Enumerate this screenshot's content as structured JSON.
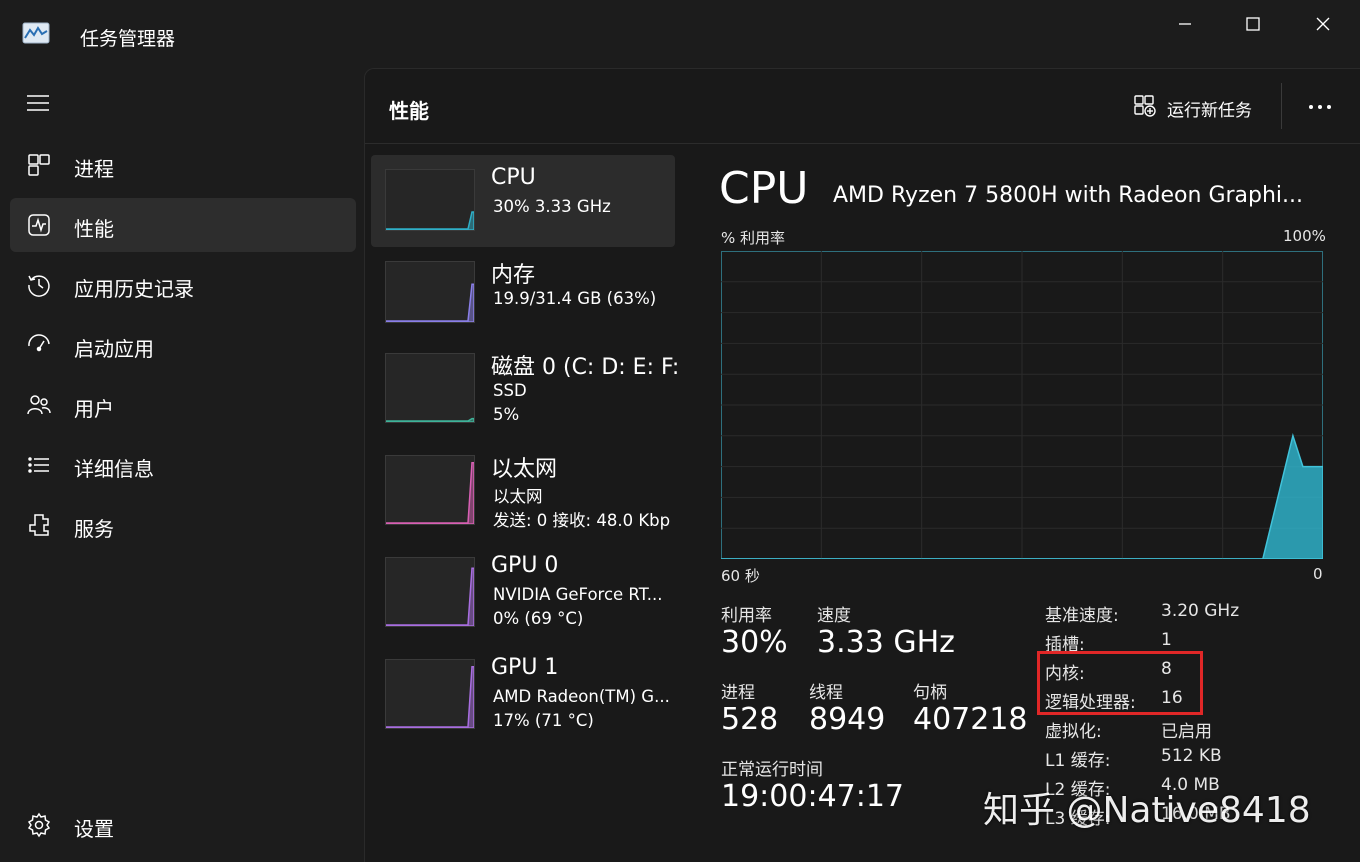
{
  "window": {
    "title": "任务管理器"
  },
  "sidebar": {
    "items": [
      {
        "label": "进程",
        "icon": "processes-icon"
      },
      {
        "label": "性能",
        "icon": "performance-icon",
        "active": true
      },
      {
        "label": "应用历史记录",
        "icon": "history-icon"
      },
      {
        "label": "启动应用",
        "icon": "startup-icon"
      },
      {
        "label": "用户",
        "icon": "users-icon"
      },
      {
        "label": "详细信息",
        "icon": "details-icon"
      },
      {
        "label": "服务",
        "icon": "services-icon"
      }
    ],
    "settings_label": "设置"
  },
  "header": {
    "title": "性能",
    "run_task_label": "运行新任务"
  },
  "resources": [
    {
      "name": "CPU",
      "line1": "30%  3.33 GHz",
      "line2": "",
      "color": "#2fb0c8",
      "level": 0.3
    },
    {
      "name": "内存",
      "line1": "19.9/31.4 GB (63%)",
      "line2": "",
      "color": "#8a7fe8",
      "level": 0.63
    },
    {
      "name": "磁盘 0 (C: D: E: F:",
      "line1": "SSD",
      "line2": "5%",
      "color": "#3fb39a",
      "level": 0.05
    },
    {
      "name": "以太网",
      "line1": "以太网",
      "line2": "发送: 0 接收: 48.0 Kbp",
      "color": "#d860b4",
      "level": 0.9
    },
    {
      "name": "GPU 0",
      "line1": "NVIDIA GeForce RT...",
      "line2": "0% (69 °C)",
      "color": "#a86ee0",
      "level": 0.85
    },
    {
      "name": "GPU 1",
      "line1": "AMD Radeon(TM) G...",
      "line2": "17% (71 °C)",
      "color": "#a86ee0",
      "level": 0.9
    }
  ],
  "cpu": {
    "heading": "CPU",
    "model": "AMD Ryzen 7 5800H with Radeon Graphi...",
    "util_axis_label": "% 利用率",
    "util_axis_max": "100%",
    "time_axis_left": "60 秒",
    "time_axis_right": "0",
    "stats": {
      "util_label": "利用率",
      "util_value": "30%",
      "speed_label": "速度",
      "speed_value": "3.33 GHz",
      "proc_label": "进程",
      "proc_value": "528",
      "thread_label": "线程",
      "thread_value": "8949",
      "handle_label": "句柄",
      "handle_value": "407218",
      "uptime_label": "正常运行时间",
      "uptime_value": "19:00:47:17"
    },
    "details": [
      {
        "key": "基准速度:",
        "value": "3.20 GHz"
      },
      {
        "key": "插槽:",
        "value": "1"
      },
      {
        "key": "内核:",
        "value": "8"
      },
      {
        "key": "逻辑处理器:",
        "value": "16"
      },
      {
        "key": "虚拟化:",
        "value": "已启用"
      },
      {
        "key": "L1 缓存:",
        "value": "512 KB"
      },
      {
        "key": "L2 缓存:",
        "value": "4.0 MB"
      },
      {
        "key": "L3 缓存:",
        "value": "16.0 MB"
      }
    ]
  },
  "chart_data": {
    "type": "area",
    "ylim": [
      0,
      100
    ],
    "x": [
      0,
      54,
      57,
      58,
      60
    ],
    "values": [
      0,
      0,
      40,
      30,
      30
    ],
    "color": "#2fb0c8"
  },
  "watermark": "知乎 @Native8418",
  "colors": {
    "accent": "#2fb0c8",
    "highlight": "#e02727"
  }
}
